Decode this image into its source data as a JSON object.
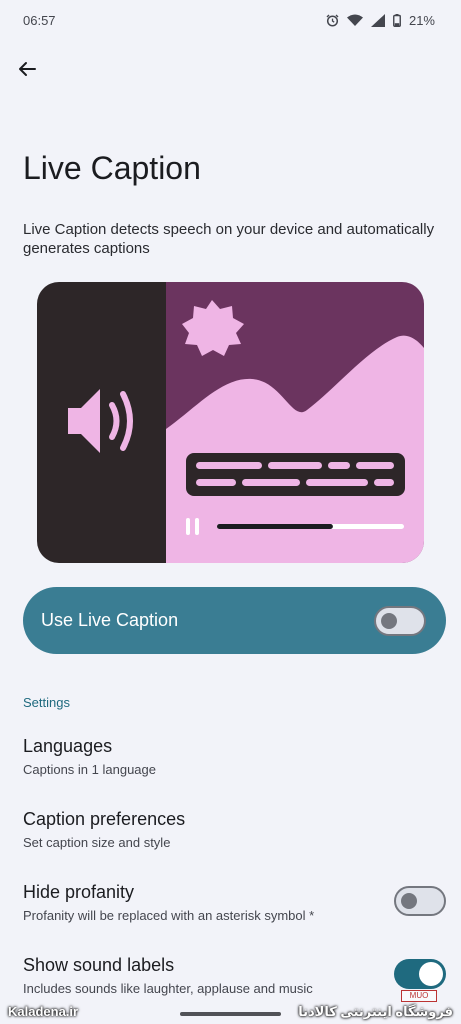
{
  "status_bar": {
    "time": "06:57",
    "battery": "21%",
    "icons": [
      "alarm-icon",
      "wifi-icon",
      "signal-hd-icon",
      "battery-icon"
    ]
  },
  "header": {
    "back_icon": "arrow-left-icon",
    "title": "Live Caption",
    "description": "Live Caption detects speech on your device and automatically generates captions"
  },
  "illustration": {
    "icons": [
      "speaker-icon",
      "sun-icon",
      "pause-icon"
    ],
    "colors": {
      "left_panel": "#2d2628",
      "sky": "#6b345f",
      "hills": "#efb5e5",
      "caption_box": "#2d2628",
      "caption_lines": "#efb5e5",
      "progress_fill": "#1b1c20",
      "progress_track": "#ffffff"
    },
    "progress": 0.62
  },
  "main_toggle": {
    "label": "Use Live Caption",
    "state": "off",
    "color": "#3a7d93"
  },
  "settings": {
    "header": "Settings",
    "items": [
      {
        "title": "Languages",
        "subtitle": "Captions in 1 language"
      },
      {
        "title": "Caption preferences",
        "subtitle": "Set caption size and style"
      },
      {
        "title": "Hide profanity",
        "subtitle": "Profanity will be replaced with an asterisk symbol *",
        "switch": "off"
      },
      {
        "title": "Show sound labels",
        "subtitle": "Includes sounds like laughter, applause and music",
        "switch": "on"
      }
    ]
  },
  "watermark": {
    "left": "Kaladena.ir",
    "right": "فروشگاه اینترنتی کالادنا",
    "logo": "MUO"
  }
}
